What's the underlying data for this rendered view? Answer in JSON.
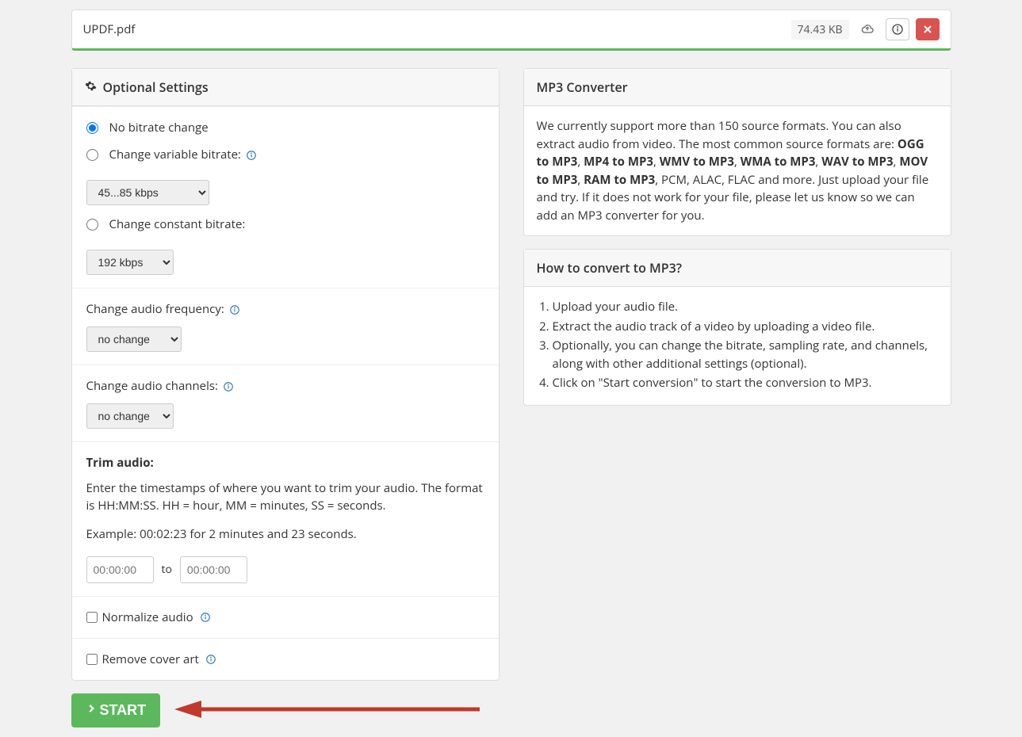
{
  "file": {
    "name": "UPDF.pdf",
    "size": "74.43 KB"
  },
  "settings": {
    "title": "Optional Settings",
    "bitrate": {
      "no_change": "No bitrate change",
      "variable_label": "Change variable bitrate:",
      "variable_selected": "45...85 kbps",
      "constant_label": "Change constant bitrate:",
      "constant_selected": "192 kbps"
    },
    "frequency": {
      "label": "Change audio frequency:",
      "selected": "no change"
    },
    "channels": {
      "label": "Change audio channels:",
      "selected": "no change"
    },
    "trim": {
      "label": "Trim audio:",
      "desc": "Enter the timestamps of where you want to trim your audio. The format is HH:MM:SS. HH = hour, MM = minutes, SS = seconds.",
      "example": "Example: 00:02:23 for 2 minutes and 23 seconds.",
      "placeholder": "00:00:00",
      "to": "to"
    },
    "normalize": "Normalize audio",
    "remove_cover": "Remove cover art"
  },
  "start_label": "START",
  "info_panel": {
    "title": "MP3 Converter",
    "text_1": "We currently support more than 150 source formats. You can also extract audio from video. The most common source formats are: ",
    "formats": [
      "OGG to MP3",
      "MP4 to MP3",
      "WMV to MP3",
      "WMA to MP3",
      "WAV to MP3",
      "MOV to MP3",
      "RAM to MP3"
    ],
    "text_2": ", PCM, ALAC, FLAC and more. Just upload your file and try. If it does not work for your file, please let us know so we can add an MP3 converter for you."
  },
  "howto": {
    "title": "How to convert to MP3?",
    "steps": [
      "Upload your audio file.",
      "Extract the audio track of a video by uploading a video file.",
      "Optionally, you can change the bitrate, sampling rate, and channels, along with other additional settings (optional).",
      "Click on \"Start conversion\" to start the conversion to MP3."
    ]
  }
}
